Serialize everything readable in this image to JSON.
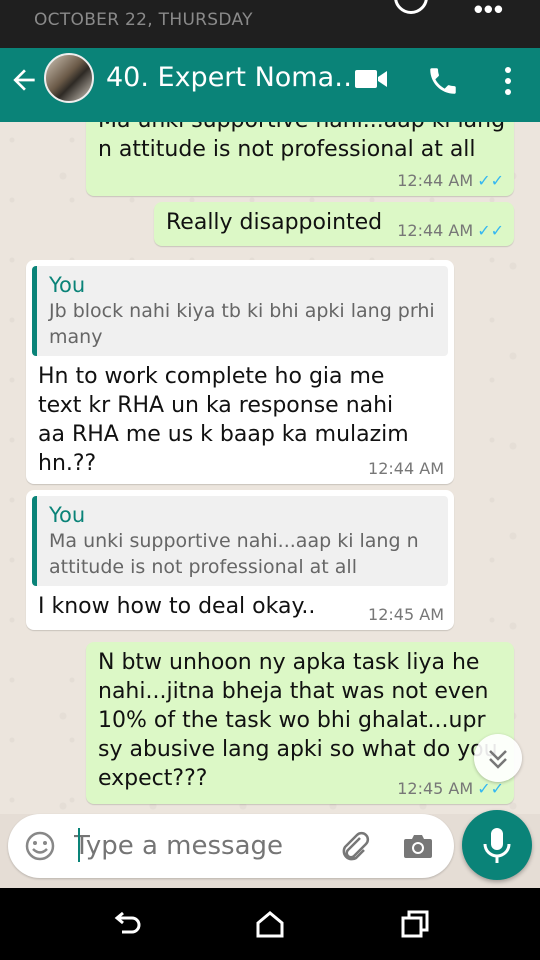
{
  "status_bar": {
    "date": "OCTOBER 22, THURSDAY",
    "dots": "•••"
  },
  "header": {
    "title": "40. Expert Noma…",
    "avatar_icon": "contact-avatar",
    "accent": "#0a8378"
  },
  "messages": [
    {
      "id": "m1",
      "direction": "out",
      "text_top": "Ma unki supportive nahi...aap ki lang",
      "text": "n attitude is not professional at all",
      "time": "12:44 AM",
      "read": true
    },
    {
      "id": "m2",
      "direction": "out",
      "text": "Really disappointed",
      "time": "12:44 AM",
      "read": true
    },
    {
      "id": "m3",
      "direction": "in",
      "quote_author": "You",
      "quote_text": "Jb block nahi kiya tb ki bhi apki lang prhi many",
      "text": "Hn to work complete ho gia me text kr RHA un ka response nahi aa RHA me us k baap ka mulazim hn.??",
      "time": "12:44 AM"
    },
    {
      "id": "m4",
      "direction": "in",
      "quote_author": "You",
      "quote_text": "Ma unki supportive nahi...aap ki lang n attitude is not professional at all",
      "text": "I know how to deal okay..",
      "time": "12:45 AM"
    },
    {
      "id": "m5",
      "direction": "out",
      "text": "N btw unhoon ny apka task liya he nahi...jitna bheja that was not even 10% of the task wo bhi ghalat...upr sy abusive lang apki so what do you expect???",
      "time": "12:45 AM",
      "read": true
    }
  ],
  "composer": {
    "placeholder": "Type a message"
  },
  "colors": {
    "outgoing_bubble": "#dcf8c6",
    "incoming_bubble": "#ffffff",
    "read_ticks": "#34b7f1"
  },
  "icons": [
    "back-arrow-icon",
    "video-call-icon",
    "phone-icon",
    "more-options-icon",
    "emoji-icon",
    "attach-icon",
    "camera-icon",
    "mic-icon",
    "scroll-down-icon",
    "nav-back-icon",
    "nav-home-icon",
    "nav-recents-icon"
  ]
}
